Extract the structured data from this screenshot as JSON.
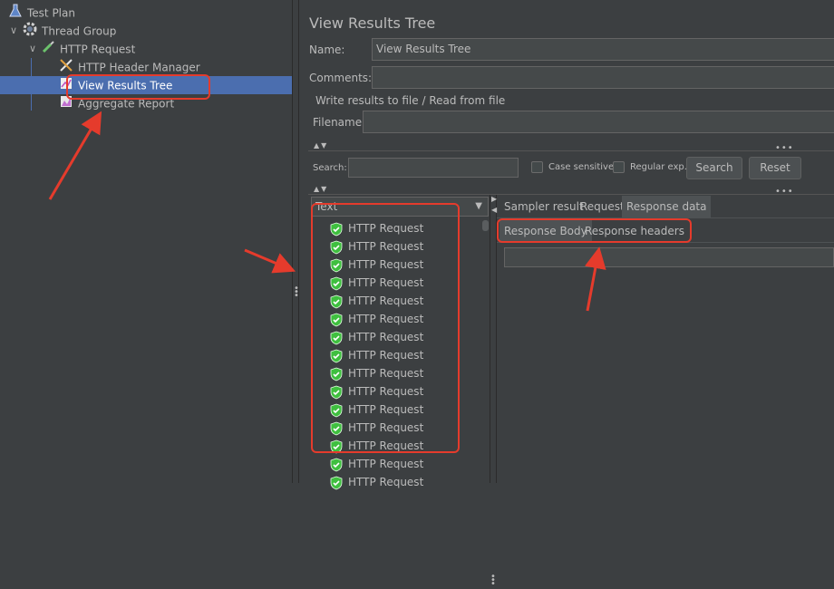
{
  "tree": {
    "items": [
      {
        "label": "Test Plan",
        "icon": "flask-icon"
      },
      {
        "label": "Thread Group",
        "icon": "gear-icon"
      },
      {
        "label": "HTTP Request",
        "icon": "pipette-icon"
      },
      {
        "label": "HTTP Header Manager",
        "icon": "wrench-icon"
      },
      {
        "label": "View Results Tree",
        "icon": "chart-icon"
      },
      {
        "label": "Aggregate Report",
        "icon": "chart-icon"
      }
    ],
    "selected_color": "#4b6eaf"
  },
  "panel": {
    "title": "View Results Tree",
    "name_label": "Name:",
    "name_value": "View Results Tree",
    "comments_label": "Comments:",
    "file_section": "Write results to file / Read from file",
    "filename_label": "Filename",
    "search_label": "Search:",
    "case_sensitive": "Case sensitive",
    "regular_exp": "Regular exp.",
    "search_button": "Search",
    "reset_button": "Reset",
    "renderer": "Text",
    "tabs": [
      "Sampler result",
      "Request",
      "Response data"
    ],
    "subtabs": [
      "Response Body",
      "Response headers"
    ]
  },
  "results": {
    "label": "HTTP Request",
    "count_visible": 15,
    "success_color": "#3fbf3f"
  },
  "annotation_color": "#e53b2c"
}
